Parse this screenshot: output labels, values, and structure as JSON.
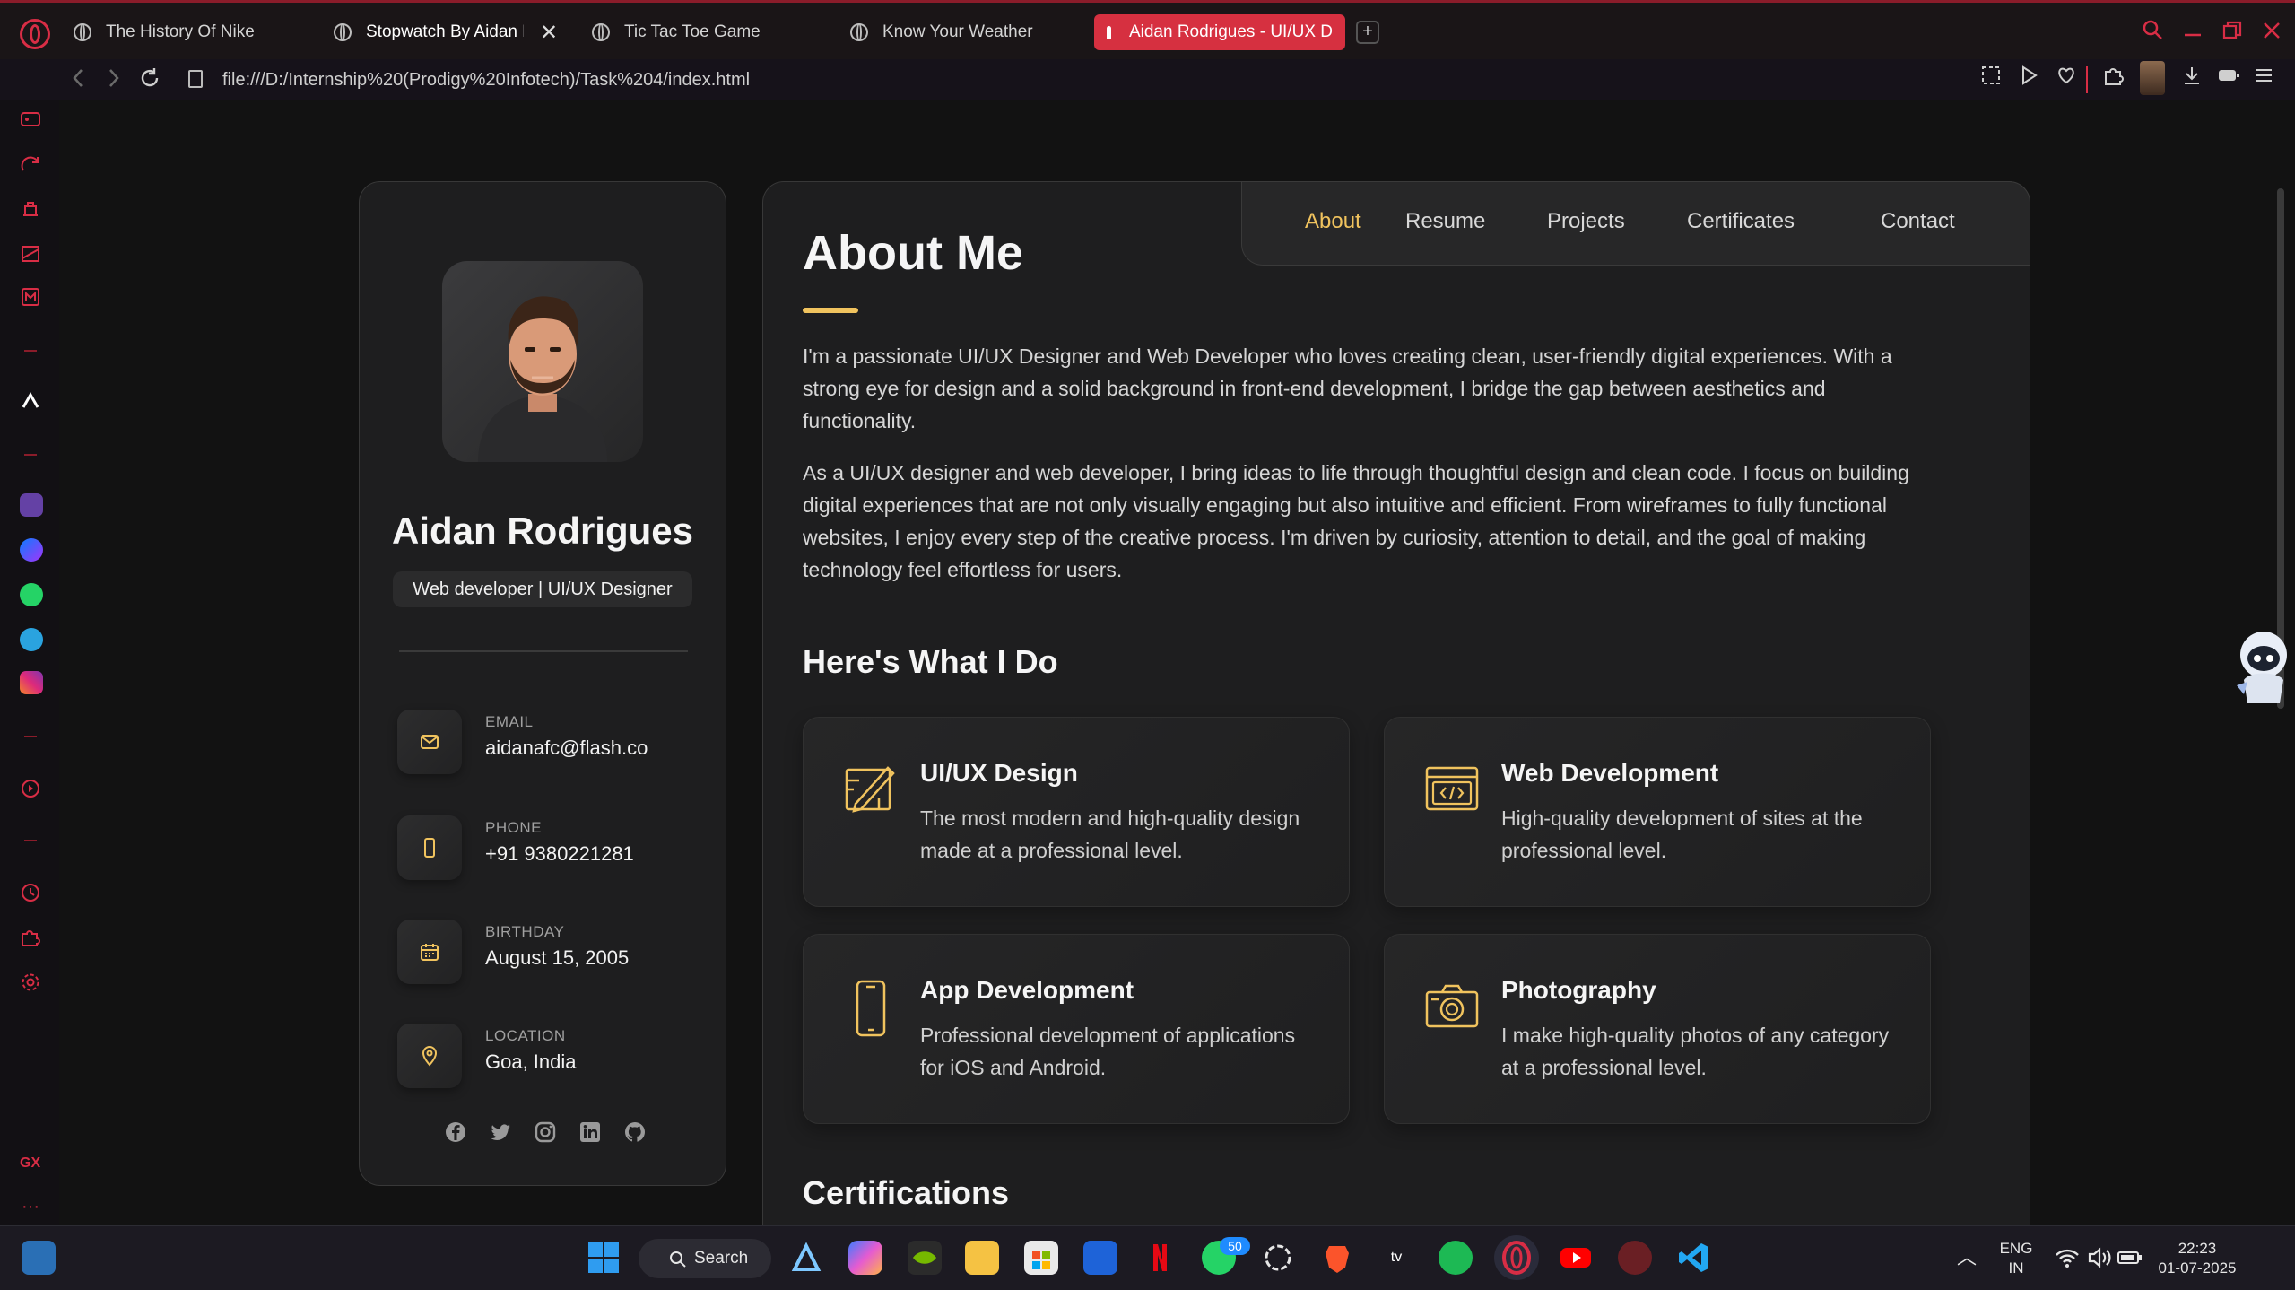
{
  "browser": {
    "tabs": [
      {
        "title": "The History Of Nike"
      },
      {
        "title": "Stopwatch By Aidan R"
      },
      {
        "title": "Tic Tac Toe Game"
      },
      {
        "title": "Know Your Weather"
      },
      {
        "title": "Aidan Rodrigues - UI/UX D"
      }
    ],
    "url": "file:///D:/Internship%20(Prodigy%20Infotech)/Task%204/index.html",
    "accent_color": "#d82d45"
  },
  "profile": {
    "name": "Aidan Rodrigues",
    "role": "Web developer | UI/UX Designer",
    "contacts": [
      {
        "label": "EMAIL",
        "value": "aidanafc@flash.co",
        "icon": "mail-icon"
      },
      {
        "label": "PHONE",
        "value": "+91 9380221281",
        "icon": "phone-icon"
      },
      {
        "label": "BIRTHDAY",
        "value": "August 15, 2005",
        "icon": "calendar-icon"
      },
      {
        "label": "LOCATION",
        "value": "Goa, India",
        "icon": "location-pin-icon"
      }
    ],
    "socials": [
      "facebook-icon",
      "twitter-icon",
      "instagram-icon",
      "linkedin-icon",
      "github-icon"
    ]
  },
  "nav": {
    "links": [
      "About",
      "Resume",
      "Projects",
      "Certificates",
      "Contact"
    ],
    "active": "About",
    "active_color": "#f0c35e"
  },
  "about": {
    "title": "About Me",
    "paragraphs": [
      "I'm a passionate UI/UX Designer and Web Developer who loves creating clean, user-friendly digital experiences. With a strong eye for design and a solid background in front-end development, I bridge the gap between aesthetics and functionality.",
      "As a UI/UX designer and web developer, I bring ideas to life through thoughtful design and clean code. I focus on building digital experiences that are not only visually engaging but also intuitive and efficient. From wireframes to fully functional websites, I enjoy every step of the creative process. I'm driven by curiosity, attention to detail, and the goal of making technology feel effortless for users."
    ],
    "services_title": "Here's What I Do",
    "services": [
      {
        "title": "UI/UX Design",
        "desc": "The most modern and high-quality design made at a professional level.",
        "icon": "design-icon"
      },
      {
        "title": "Web Development",
        "desc": "High-quality development of sites at the professional level.",
        "icon": "code-window-icon"
      },
      {
        "title": "App Development",
        "desc": "Professional development of applications for iOS and Android.",
        "icon": "smartphone-icon"
      },
      {
        "title": "Photography",
        "desc": "I make high-quality photos of any category at a professional level.",
        "icon": "camera-icon"
      }
    ],
    "certifications_title": "Certifications"
  },
  "taskbar": {
    "search_label": "Search",
    "whatsapp_badge": "50",
    "lang": "ENG",
    "region": "IN",
    "time": "22:23",
    "date": "01-07-2025"
  }
}
